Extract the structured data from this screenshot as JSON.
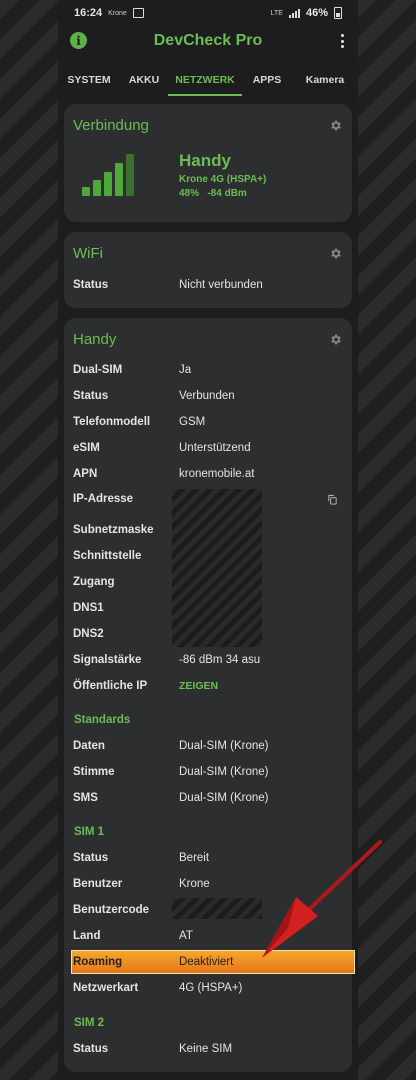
{
  "status_bar": {
    "time": "16:24",
    "mini_label": "Krone",
    "mini_net": "LTE",
    "battery": "46%"
  },
  "app": {
    "title": "DevCheck Pro"
  },
  "tabs": [
    {
      "label": "SYSTEM"
    },
    {
      "label": "AKKU"
    },
    {
      "label": "NETZWERK",
      "active": true
    },
    {
      "label": "APPS"
    },
    {
      "label": "Kamera"
    }
  ],
  "verbindung": {
    "title": "Verbindung",
    "type": "Handy",
    "network": "Krone 4G (HSPA+)",
    "signal": "48%   -84 dBm"
  },
  "wifi": {
    "title": "WiFi",
    "rows": [
      {
        "key": "Status",
        "value": "Nicht verbunden"
      }
    ]
  },
  "handy": {
    "title": "Handy",
    "rows": [
      {
        "key": "Dual-SIM",
        "value": "Ja"
      },
      {
        "key": "Status",
        "value": "Verbunden"
      },
      {
        "key": "Telefonmodell",
        "value": "GSM"
      },
      {
        "key": "eSIM",
        "value": "Unterstützend"
      },
      {
        "key": "APN",
        "value": "kronemobile.at"
      },
      {
        "key": "IP-Adresse",
        "value": ""
      },
      {
        "key": "Subnetzmaske",
        "value": ""
      },
      {
        "key": "Schnittstelle",
        "value": ""
      },
      {
        "key": "Zugang",
        "value": ""
      },
      {
        "key": "DNS1",
        "value": ""
      },
      {
        "key": "DNS2",
        "value": ""
      },
      {
        "key": "Signalstärke",
        "value": "-86 dBm 34 asu"
      },
      {
        "key": "Öffentliche IP",
        "value": "ZEIGEN"
      }
    ],
    "standards_title": "Standards",
    "standards": [
      {
        "key": "Daten",
        "value": "Dual-SIM (Krone)"
      },
      {
        "key": "Stimme",
        "value": "Dual-SIM (Krone)"
      },
      {
        "key": "SMS",
        "value": "Dual-SIM (Krone)"
      }
    ],
    "sim1_title": "SIM 1",
    "sim1": [
      {
        "key": "Status",
        "value": "Bereit"
      },
      {
        "key": "Benutzer",
        "value": "Krone"
      },
      {
        "key": "Benutzercode",
        "value": ""
      },
      {
        "key": "Land",
        "value": "AT"
      },
      {
        "key": "Roaming",
        "value": "Deaktiviert"
      },
      {
        "key": "Netzwerkart",
        "value": "4G (HSPA+)"
      }
    ],
    "sim2_title": "SIM 2",
    "sim2": [
      {
        "key": "Status",
        "value": "Keine SIM"
      }
    ]
  },
  "colors": {
    "accent": "#6bbd53",
    "card": "#2d2e30",
    "highlight": "#f6a62c",
    "arrow": "#d42020"
  }
}
